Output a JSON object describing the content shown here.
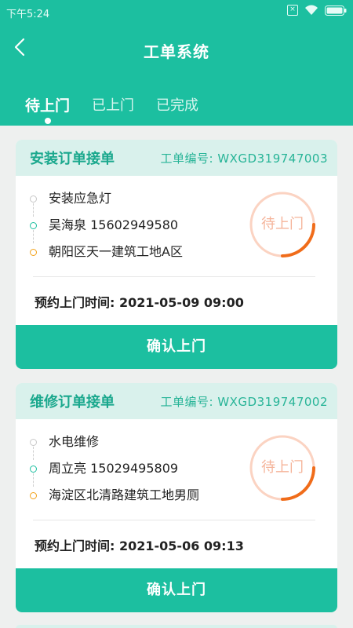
{
  "status_bar": {
    "time": "下午5:24"
  },
  "header": {
    "title": "工单系统"
  },
  "tabs": [
    {
      "label": "待上门",
      "active": true
    },
    {
      "label": "已上门",
      "active": false
    },
    {
      "label": "已完成",
      "active": false
    }
  ],
  "orders": [
    {
      "type": "安装订单接单",
      "order_no": "工单编号: WXGD319747003",
      "service": "安装应急灯",
      "contact": "吴海泉 15602949580",
      "address": "朝阳区天一建筑工地A区",
      "status": "待上门",
      "appointment_label": "预约上门时间:",
      "appointment_time": "2021-05-09 09:00",
      "confirm_label": "确认上门"
    },
    {
      "type": "维修订单接单",
      "order_no": "工单编号: WXGD319747002",
      "service": "水电维修",
      "contact": "周立亮 15029495809",
      "address": "海淀区北清路建筑工地男厕",
      "status": "待上门",
      "appointment_label": "预约上门时间:",
      "appointment_time": "2021-05-06 09:13",
      "confirm_label": "确认上门"
    }
  ],
  "colors": {
    "primary": "#1cbfa0",
    "ring_light": "#fbd3c2",
    "ring_accent": "#f06c1a",
    "dot_orange": "#f3a21a"
  },
  "icons": {
    "back": "chevron-left-icon",
    "wifi": "wifi-icon",
    "battery": "battery-icon",
    "sim": "sim-icon"
  }
}
